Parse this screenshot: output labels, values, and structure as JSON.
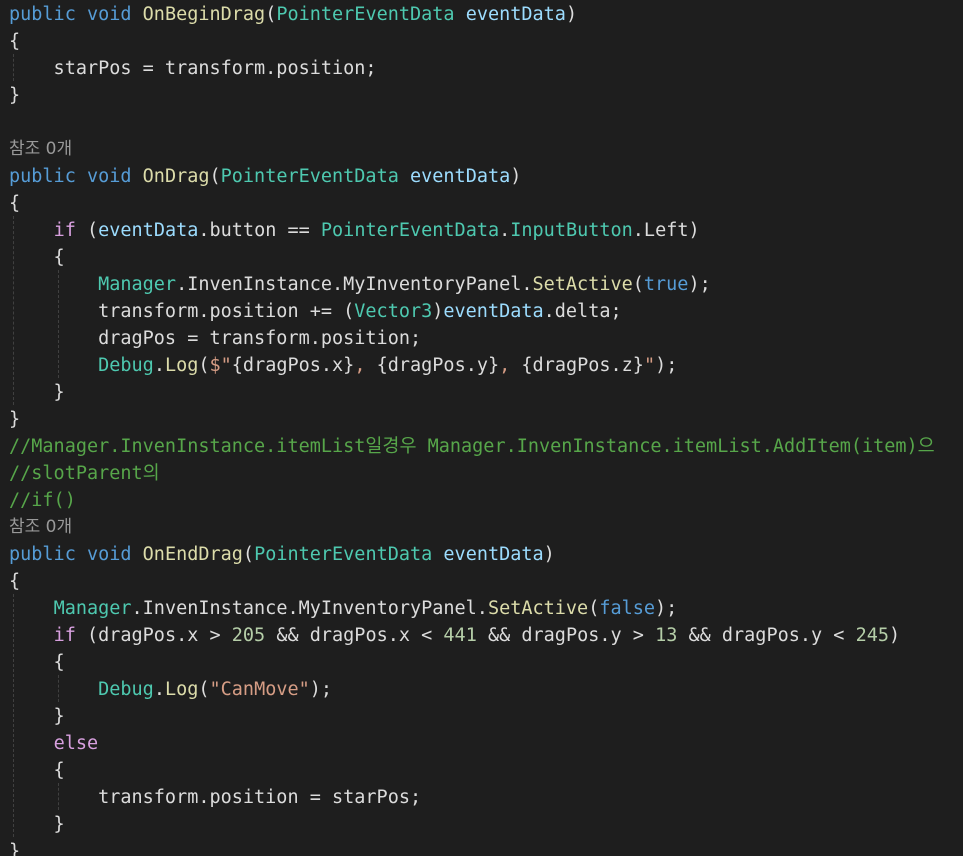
{
  "editor": {
    "colors": {
      "background": "#1e1e1e",
      "keyword": "#569cd6",
      "control": "#d8a0df",
      "type": "#4ec9b0",
      "method": "#dcdcaa",
      "parameter": "#9cdcfe",
      "string": "#d69d85",
      "number": "#b5cea8",
      "comment": "#57a64a",
      "codelens": "#999999",
      "plain": "#dcdcdc"
    },
    "lines": [
      {
        "kind": "code",
        "tokens": [
          [
            "kw",
            "public"
          ],
          [
            "plain",
            " "
          ],
          [
            "kw",
            "void"
          ],
          [
            "plain",
            " "
          ],
          [
            "method",
            "OnBeginDrag"
          ],
          [
            "plain",
            "("
          ],
          [
            "type",
            "PointerEventData"
          ],
          [
            "plain",
            " "
          ],
          [
            "param",
            "eventData"
          ],
          [
            "plain",
            ")"
          ]
        ]
      },
      {
        "kind": "code",
        "tokens": [
          [
            "plain",
            "{"
          ]
        ]
      },
      {
        "kind": "code",
        "tokens": [
          [
            "plain",
            "    starPos = transform.position;"
          ]
        ]
      },
      {
        "kind": "code",
        "tokens": [
          [
            "plain",
            "}"
          ]
        ]
      },
      {
        "kind": "blank",
        "tokens": []
      },
      {
        "kind": "codelens",
        "tokens": [
          [
            "codelens",
            "참조 0개"
          ]
        ]
      },
      {
        "kind": "code",
        "tokens": [
          [
            "kw",
            "public"
          ],
          [
            "plain",
            " "
          ],
          [
            "kw",
            "void"
          ],
          [
            "plain",
            " "
          ],
          [
            "method",
            "OnDrag"
          ],
          [
            "plain",
            "("
          ],
          [
            "type",
            "PointerEventData"
          ],
          [
            "plain",
            " "
          ],
          [
            "param",
            "eventData"
          ],
          [
            "plain",
            ")"
          ]
        ]
      },
      {
        "kind": "code",
        "tokens": [
          [
            "plain",
            "{"
          ]
        ]
      },
      {
        "kind": "code",
        "tokens": [
          [
            "plain",
            "    "
          ],
          [
            "ctrl",
            "if"
          ],
          [
            "plain",
            " ("
          ],
          [
            "param",
            "eventData"
          ],
          [
            "plain",
            ".button == "
          ],
          [
            "type",
            "PointerEventData"
          ],
          [
            "plain",
            "."
          ],
          [
            "type",
            "InputButton"
          ],
          [
            "plain",
            ".Left)"
          ]
        ]
      },
      {
        "kind": "code",
        "tokens": [
          [
            "plain",
            "    {"
          ]
        ]
      },
      {
        "kind": "code",
        "tokens": [
          [
            "plain",
            "        "
          ],
          [
            "type",
            "Manager"
          ],
          [
            "plain",
            ".InvenInstance.MyInventoryPanel."
          ],
          [
            "method",
            "SetActive"
          ],
          [
            "plain",
            "("
          ],
          [
            "kw",
            "true"
          ],
          [
            "plain",
            ");"
          ]
        ]
      },
      {
        "kind": "code",
        "tokens": [
          [
            "plain",
            "        transform.position += ("
          ],
          [
            "type",
            "Vector3"
          ],
          [
            "plain",
            ")"
          ],
          [
            "param",
            "eventData"
          ],
          [
            "plain",
            ".delta;"
          ]
        ]
      },
      {
        "kind": "code",
        "tokens": [
          [
            "plain",
            "        dragPos = transform.position;"
          ]
        ]
      },
      {
        "kind": "code",
        "tokens": [
          [
            "plain",
            "        "
          ],
          [
            "type",
            "Debug"
          ],
          [
            "plain",
            "."
          ],
          [
            "method",
            "Log"
          ],
          [
            "plain",
            "("
          ],
          [
            "str",
            "$\""
          ],
          [
            "plain",
            "{dragPos.x}"
          ],
          [
            "str",
            ", "
          ],
          [
            "plain",
            "{dragPos.y}"
          ],
          [
            "str",
            ", "
          ],
          [
            "plain",
            "{dragPos.z}"
          ],
          [
            "str",
            "\""
          ],
          [
            "plain",
            ");"
          ]
        ]
      },
      {
        "kind": "code",
        "tokens": [
          [
            "plain",
            "    }"
          ]
        ]
      },
      {
        "kind": "code",
        "tokens": [
          [
            "plain",
            "}"
          ]
        ]
      },
      {
        "kind": "comment",
        "tokens": [
          [
            "cmt",
            "//Manager.InvenInstance.itemList일경우 Manager.InvenInstance.itemList.AddItem(item)으"
          ]
        ]
      },
      {
        "kind": "comment",
        "tokens": [
          [
            "cmt",
            "//slotParent의"
          ]
        ]
      },
      {
        "kind": "comment",
        "tokens": [
          [
            "cmt",
            "//if()"
          ]
        ]
      },
      {
        "kind": "codelens",
        "tokens": [
          [
            "codelens",
            "참조 0개"
          ]
        ]
      },
      {
        "kind": "code",
        "tokens": [
          [
            "kw",
            "public"
          ],
          [
            "plain",
            " "
          ],
          [
            "kw",
            "void"
          ],
          [
            "plain",
            " "
          ],
          [
            "method",
            "OnEndDrag"
          ],
          [
            "plain",
            "("
          ],
          [
            "type",
            "PointerEventData"
          ],
          [
            "plain",
            " "
          ],
          [
            "param",
            "eventData"
          ],
          [
            "plain",
            ")"
          ]
        ]
      },
      {
        "kind": "code",
        "tokens": [
          [
            "plain",
            "{"
          ]
        ]
      },
      {
        "kind": "code",
        "tokens": [
          [
            "plain",
            "    "
          ],
          [
            "type",
            "Manager"
          ],
          [
            "plain",
            ".InvenInstance.MyInventoryPanel."
          ],
          [
            "method",
            "SetActive"
          ],
          [
            "plain",
            "("
          ],
          [
            "kw",
            "false"
          ],
          [
            "plain",
            ");"
          ]
        ]
      },
      {
        "kind": "code",
        "tokens": [
          [
            "plain",
            "    "
          ],
          [
            "ctrl",
            "if"
          ],
          [
            "plain",
            " (dragPos.x > "
          ],
          [
            "num",
            "205"
          ],
          [
            "plain",
            " && dragPos.x < "
          ],
          [
            "num",
            "441"
          ],
          [
            "plain",
            " && dragPos.y > "
          ],
          [
            "num",
            "13"
          ],
          [
            "plain",
            " && dragPos.y < "
          ],
          [
            "num",
            "245"
          ],
          [
            "plain",
            ")"
          ]
        ]
      },
      {
        "kind": "code",
        "tokens": [
          [
            "plain",
            "    {"
          ]
        ]
      },
      {
        "kind": "code",
        "tokens": [
          [
            "plain",
            "        "
          ],
          [
            "type",
            "Debug"
          ],
          [
            "plain",
            "."
          ],
          [
            "method",
            "Log"
          ],
          [
            "plain",
            "("
          ],
          [
            "str",
            "\"CanMove\""
          ],
          [
            "plain",
            ");"
          ]
        ]
      },
      {
        "kind": "code",
        "tokens": [
          [
            "plain",
            "    }"
          ]
        ]
      },
      {
        "kind": "code",
        "tokens": [
          [
            "plain",
            "    "
          ],
          [
            "ctrl",
            "else"
          ]
        ]
      },
      {
        "kind": "code",
        "tokens": [
          [
            "plain",
            "    {"
          ]
        ]
      },
      {
        "kind": "code",
        "tokens": [
          [
            "plain",
            "        transform.position = starPos;"
          ]
        ]
      },
      {
        "kind": "code",
        "tokens": [
          [
            "plain",
            "    }"
          ]
        ]
      },
      {
        "kind": "code",
        "tokens": [
          [
            "plain",
            "}"
          ]
        ]
      }
    ]
  }
}
